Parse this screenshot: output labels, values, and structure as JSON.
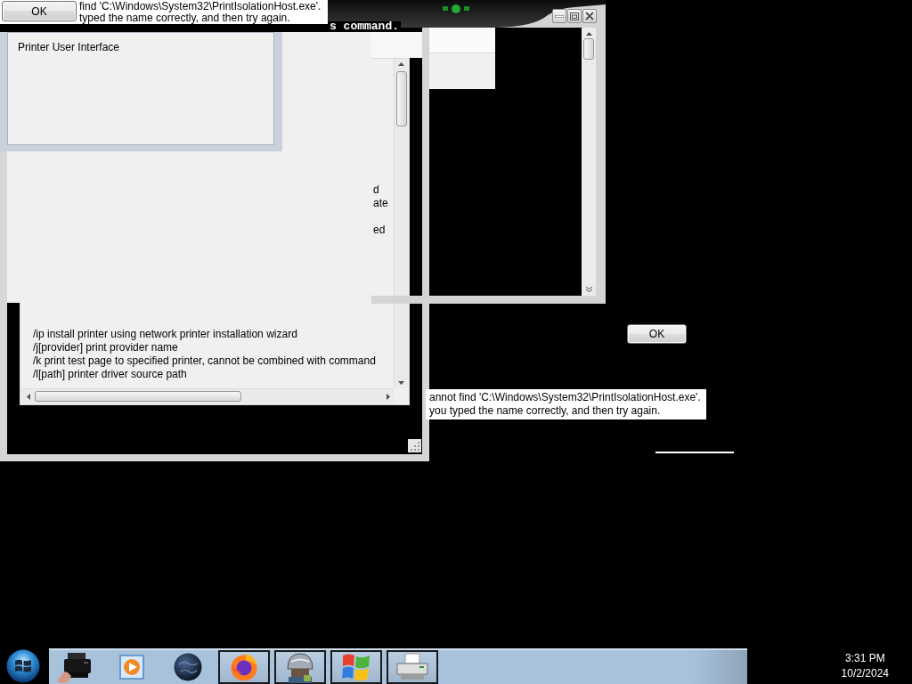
{
  "error_dialog_top": {
    "button": "OK",
    "lines": [
      "find 'C:\\Windows\\System32\\PrintIsolationHost.exe'.",
      "typed the name correctly, and then try again."
    ]
  },
  "console_text": "s command.",
  "printer_panel": {
    "title": "Printer User Interface"
  },
  "help_window": {
    "fragments": [
      "d",
      "ate",
      "ed"
    ],
    "lines": [
      "/ip install printer using network printer installation wizard",
      "/j[provider] print provider name",
      "/k print test page to specified printer, cannot be combined with command",
      "/l[path] printer driver source path"
    ]
  },
  "error_dialog_bottom": {
    "button": "OK",
    "lines": [
      "annot find 'C:\\Windows\\System32\\PrintIsolationHost.exe'.",
      "you typed the name correctly, and then try again."
    ]
  },
  "taskbar": {
    "items": [
      {
        "open": false
      },
      {
        "open": false
      },
      {
        "open": false
      },
      {
        "open": true
      },
      {
        "open": true
      },
      {
        "open": true
      },
      {
        "open": true
      }
    ]
  },
  "clock": {
    "time": "3:31 PM",
    "date": "10/2/2024"
  }
}
